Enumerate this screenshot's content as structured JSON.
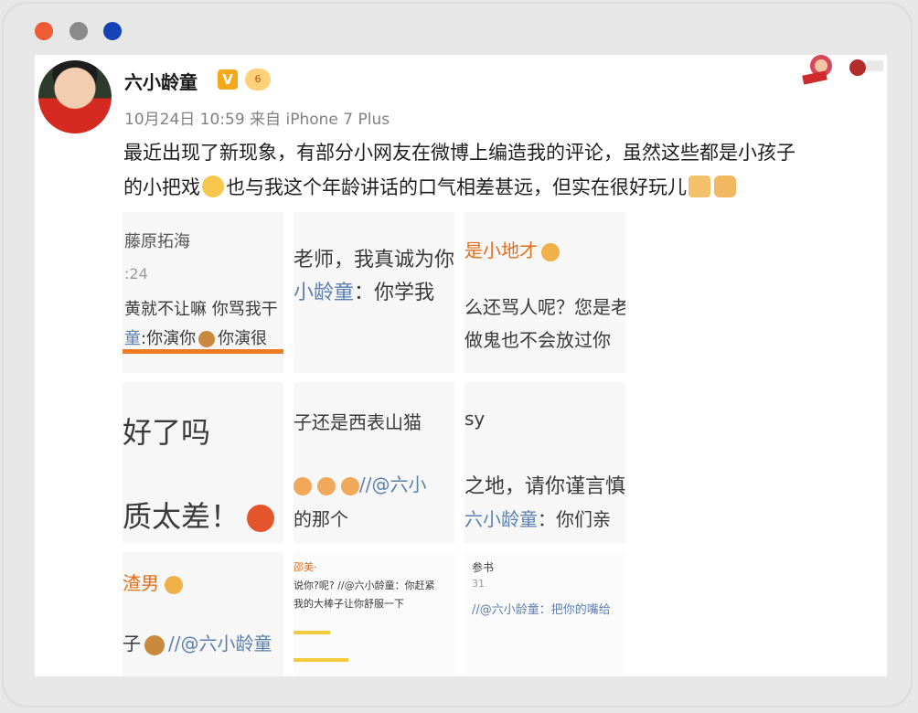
{
  "window": {
    "controls": [
      "close",
      "minimize",
      "zoom"
    ]
  },
  "post": {
    "author": "六小龄童",
    "verified_badge": "V",
    "level_badge": "6",
    "meta": "10月24日 10:59 来自 iPhone 7 Plus",
    "text_line1": "最近出现了新现象，有部分小网友在微博上编造我的评论，虽然这些都是小孩子",
    "text_line2a": "的小把戏",
    "text_line2b": "也与我这个年龄讲话的口气相差甚远，但实在很好玩儿"
  },
  "grid": {
    "c1": {
      "l1": "藤原拓海",
      "l2": ":24",
      "l3": "黄就不让嘛 你骂我干",
      "l4a": "童",
      "l4b": ":你演你",
      "l4c": "你演很"
    },
    "c2": {
      "l1": "老师，我真诚为你",
      "l2a": "小龄童",
      "l2b": "：你学我"
    },
    "c3": {
      "l1": "是小地才",
      "l2": "么还骂人呢？您是老",
      "l3": "做鬼也不会放过你"
    },
    "c4": {
      "l1": "好了吗",
      "l2": "质太差！"
    },
    "c5": {
      "l1": "子还是西表山猫",
      "l2": "//@六小",
      "l3": "的那个"
    },
    "c6": {
      "l1": "sy",
      "l2": "之地，请你谨言慎",
      "l3a": "六小龄童",
      "l3b": "：你们亲"
    },
    "c7": {
      "l1": "渣男",
      "l2": "子",
      "l3": "//@六小龄童"
    },
    "c8": {
      "l1": "邵美·",
      "l2": "说你?呢? //@六小龄童：你赶紧",
      "l3": "我的大棒子让你舒服一下"
    },
    "c9": {
      "l1": "参书",
      "l2": "31",
      "l3": "//@六小龄童：把你的嘴给"
    }
  },
  "colors": {
    "accent_orange": "#e36f1a",
    "link_blue": "#5b7fb0"
  }
}
